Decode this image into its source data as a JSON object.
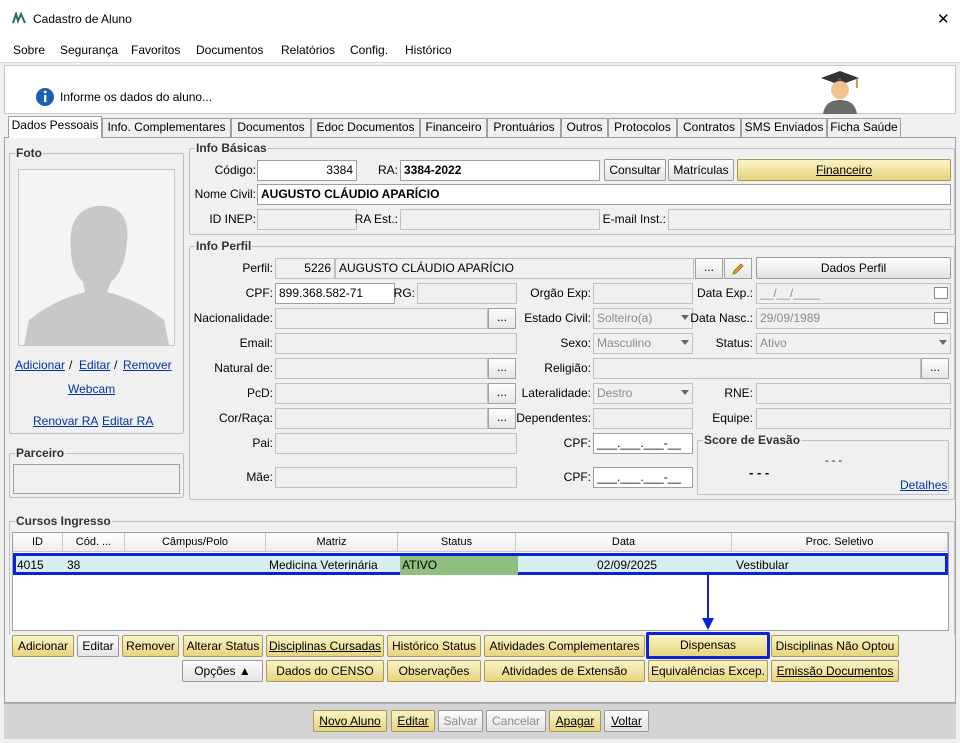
{
  "window": {
    "title": "Cadastro de Aluno",
    "close": "✕"
  },
  "menu": [
    {
      "label": "Sobre"
    },
    {
      "label": "Segurança"
    },
    {
      "label": "Favoritos"
    },
    {
      "label": "Documentos"
    },
    {
      "label": "Relatórios"
    },
    {
      "label": "Config."
    },
    {
      "label": "Histórico"
    }
  ],
  "info": {
    "message": "Informe os dados do aluno..."
  },
  "tabs": [
    "Dados Pessoais",
    "Info. Complementares",
    "Documentos",
    "Edoc Documentos",
    "Financeiro",
    "Prontuários",
    "Outros",
    "Protocolos",
    "Contratos",
    "SMS Enviados",
    "Ficha Saúde"
  ],
  "foto": {
    "title": "Foto",
    "adicionar": "Adicionar",
    "sep1": "/",
    "editar": "Editar",
    "sep2": "/",
    "remover": "Remover",
    "webcam": "Webcam",
    "renovar_ra": "Renovar RA",
    "editar_ra": "Editar RA"
  },
  "parceiro": {
    "title": "Parceiro"
  },
  "basicas": {
    "title": "Info Básicas",
    "codigo_label": "Código:",
    "codigo": "3384",
    "ra_label": "RA:",
    "ra": "3384-2022",
    "consultar": "Consultar",
    "matriculas": "Matrículas",
    "financeiro": "Financeiro",
    "nome_label": "Nome Civil:",
    "nome": "AUGUSTO CLÁUDIO APARÍCIO",
    "inep_label": "ID INEP:",
    "ra_est_label": "RA Est.:",
    "email_inst_label": "E-mail Inst.:"
  },
  "perfil": {
    "title": "Info Perfil",
    "perfil_label": "Perfil:",
    "perfil_code": "5226",
    "perfil_name": "AUGUSTO CLÁUDIO APARÍCIO",
    "dots": "...",
    "dados_perfil": "Dados Perfil",
    "cpf_label": "CPF:",
    "cpf": "899.368.582-71",
    "rg_label": "RG:",
    "orgao_label": "Orgão Exp:",
    "data_exp_label": "Data Exp.:",
    "data_exp": "__/__/____",
    "nacionalidade_label": "Nacionalidade:",
    "estado_civil_label": "Estado Civil:",
    "estado_civil": "Solteiro(a)",
    "data_nasc_label": "Data Nasc.:",
    "data_nasc": "29/09/1989",
    "email_label": "Email:",
    "sexo_label": "Sexo:",
    "sexo": "Masculino",
    "status_label": "Status:",
    "status": "Ativo",
    "natural_label": "Natural de:",
    "religiao_label": "Religião:",
    "pcd_label": "PcD:",
    "lateralidade_label": "Lateralidade:",
    "lateralidade": "Destro",
    "rne_label": "RNE:",
    "cor_label": "Cor/Raça:",
    "dependentes_label": "Dependentes:",
    "equipe_label": "Equipe:",
    "pai_label": "Pai:",
    "cpf_pai_label": "CPF:",
    "cpf_pai": "___.___.___-__",
    "mae_label": "Mãe:",
    "cpf_mae_label": "CPF:",
    "cpf_mae": "___.___.___-__",
    "evasao_title": "Score de Evasão",
    "evasao_score": "- - -",
    "evasao_sub": "- - -",
    "detalhes": "Detalhes"
  },
  "cursos": {
    "title": "Cursos Ingresso",
    "columns": [
      "ID",
      "Cód. ...",
      "Câmpus/Polo",
      "Matriz",
      "Status",
      "Data",
      "Proc. Seletivo"
    ],
    "row": {
      "id": "4015",
      "cod": "38",
      "campus": "",
      "matriz": "Medicina Veterinária",
      "status": "ATIVO",
      "data": "02/09/2025",
      "proc": "Vestibular"
    }
  },
  "actions_row1": [
    "Adicionar",
    "Editar",
    "Remover",
    "Alterar Status",
    "Disciplinas Cursadas",
    "Histórico Status",
    "Atividades Complementares",
    "Dispensas",
    "Disciplinas Não Optou"
  ],
  "actions_row2": [
    "Opções ▲",
    "Dados do CENSO",
    "Observações",
    "Atividades de Extensão",
    "Equivalências Excep.",
    "Emissão Documentos"
  ],
  "bottom": [
    "Novo Aluno",
    "Editar",
    "Salvar",
    "Cancelar",
    "Apagar",
    "Voltar"
  ],
  "colors": {
    "gold": "#e6d47d",
    "highlight": "#0000cc",
    "row_bg": "#d7efef",
    "status_bg": "#8fbf80",
    "link": "#0033aa"
  }
}
